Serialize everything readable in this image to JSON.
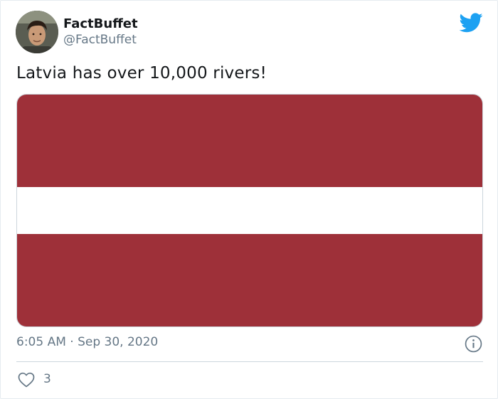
{
  "author": {
    "display_name": "FactBuffet",
    "handle": "@FactBuffet",
    "avatar_icon": "user-avatar-photo"
  },
  "brand": {
    "icon": "twitter-bird-icon",
    "color": "#1da1f2"
  },
  "tweet": {
    "text": "Latvia has over 10,000 rivers!",
    "timestamp": "6:05 AM · Sep 30, 2020",
    "likes": "3"
  },
  "media": {
    "description_icon": "latvia-flag",
    "flag_red": "#9e3039",
    "flag_white": "#ffffff"
  },
  "icons": {
    "info": "info-icon",
    "like": "heart-icon"
  },
  "colors": {
    "text_primary": "#14171a",
    "text_secondary": "#657786",
    "border": "#ccd6dd"
  }
}
